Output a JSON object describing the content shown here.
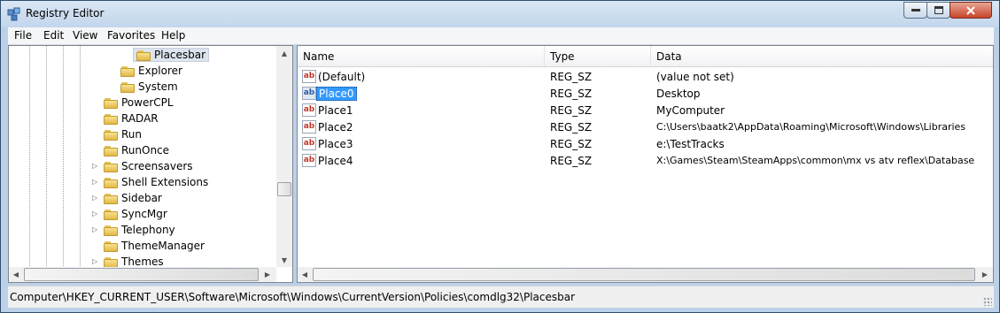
{
  "window": {
    "title": "Registry Editor"
  },
  "menu": [
    {
      "label": "File"
    },
    {
      "label": "Edit"
    },
    {
      "label": "View"
    },
    {
      "label": "Favorites"
    },
    {
      "label": "Help"
    }
  ],
  "tree": {
    "selected": "Placesbar",
    "children_of_selected_parent": [
      "Explorer",
      "System"
    ],
    "items": [
      {
        "label": "PowerCPL",
        "expandable": false
      },
      {
        "label": "RADAR",
        "expandable": false
      },
      {
        "label": "Run",
        "expandable": false
      },
      {
        "label": "RunOnce",
        "expandable": false
      },
      {
        "label": "Screensavers",
        "expandable": true
      },
      {
        "label": "Shell Extensions",
        "expandable": true
      },
      {
        "label": "Sidebar",
        "expandable": true
      },
      {
        "label": "SyncMgr",
        "expandable": true
      },
      {
        "label": "Telephony",
        "expandable": true
      },
      {
        "label": "ThemeManager",
        "expandable": false
      },
      {
        "label": "Themes",
        "expandable": true
      }
    ]
  },
  "list": {
    "columns": [
      "Name",
      "Type",
      "Data"
    ],
    "rows": [
      {
        "name": "(Default)",
        "type": "REG_SZ",
        "data": "(value not set)"
      },
      {
        "name": "Place0",
        "type": "REG_SZ",
        "data": "Desktop"
      },
      {
        "name": "Place1",
        "type": "REG_SZ",
        "data": "MyComputer"
      },
      {
        "name": "Place2",
        "type": "REG_SZ",
        "data": "C:\\Users\\baatk2\\AppData\\Roaming\\Microsoft\\Windows\\Libraries"
      },
      {
        "name": "Place3",
        "type": "REG_SZ",
        "data": "e:\\TestTracks"
      },
      {
        "name": "Place4",
        "type": "REG_SZ",
        "data": "X:\\Games\\Steam\\SteamApps\\common\\mx vs atv reflex\\Database"
      }
    ],
    "selected_row": "Place0",
    "value_icon": "ab"
  },
  "status": {
    "path": "Computer\\HKEY_CURRENT_USER\\Software\\Microsoft\\Windows\\CurrentVersion\\Policies\\comdlg32\\Placesbar"
  },
  "colors": {
    "selection": "#3399ff",
    "titlebar": "#c3d6ec"
  },
  "icons": {
    "app": "registry-icon",
    "folder": "folder-icon",
    "value": "string-value-icon"
  }
}
